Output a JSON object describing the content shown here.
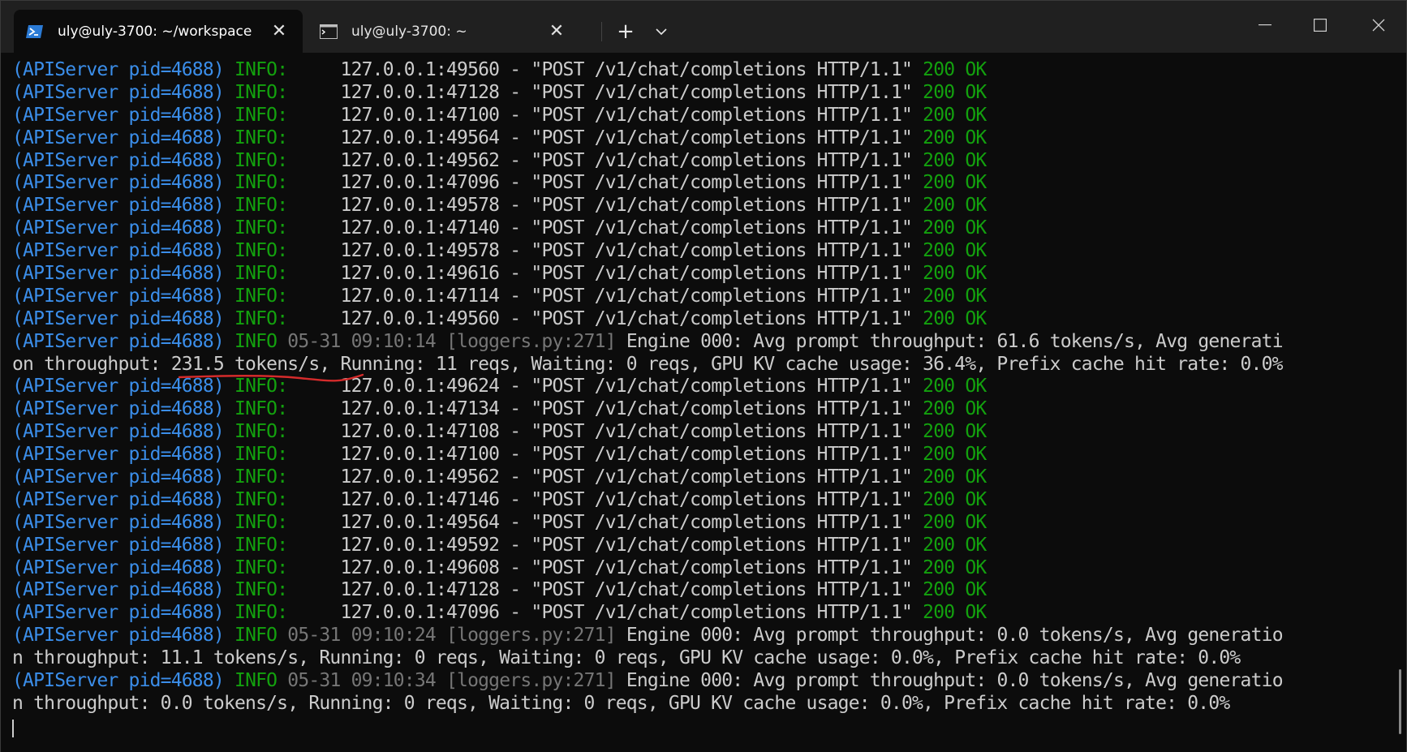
{
  "tabs": [
    {
      "label": "uly@uly-3700: ~/workspace",
      "icon": "powershell-icon",
      "active": true
    },
    {
      "label": "uly@uly-3700: ~",
      "icon": "terminal-icon",
      "active": false
    }
  ],
  "controls": {
    "new_tab": "+",
    "close": "✕"
  },
  "colors": {
    "pid": "#3b8eea",
    "info": "#13a10e",
    "ok": "#13a10e",
    "timestamp": "#767676",
    "text": "#cccccc",
    "annotation": "#d42b2b"
  },
  "log": {
    "pid": "(APIServer pid=4688)",
    "info": "INFO:",
    "info_bare": "INFO",
    "status": "200 OK",
    "request": "\"POST /v1/chat/completions HTTP/1.1\"",
    "requests_a": [
      "127.0.0.1:49560",
      "127.0.0.1:47128",
      "127.0.0.1:47100",
      "127.0.0.1:49564",
      "127.0.0.1:49562",
      "127.0.0.1:47096",
      "127.0.0.1:49578",
      "127.0.0.1:47140",
      "127.0.0.1:49578",
      "127.0.0.1:49616",
      "127.0.0.1:47114",
      "127.0.0.1:49560"
    ],
    "metric1": {
      "timestamp": "05-31 09:10:14 [loggers.py:271]",
      "line1_text": "Engine 000: Avg prompt throughput: 61.6 tokens/s, Avg generati",
      "line2_pre": "on throughput: ",
      "line2_highlight": "231.5 tokens/s,",
      "line2_post": " Running: 11 reqs, Waiting: 0 reqs, GPU KV cache usage: 36.4%, Prefix cache hit rate: 0.0%"
    },
    "requests_b": [
      "127.0.0.1:49624",
      "127.0.0.1:47134",
      "127.0.0.1:47108",
      "127.0.0.1:47100",
      "127.0.0.1:49562",
      "127.0.0.1:47146",
      "127.0.0.1:49564",
      "127.0.0.1:49592",
      "127.0.0.1:49608",
      "127.0.0.1:47128",
      "127.0.0.1:47096"
    ],
    "metric2": {
      "timestamp": "05-31 09:10:24 [loggers.py:271]",
      "line1_text": "Engine 000: Avg prompt throughput: 0.0 tokens/s, Avg generatio",
      "line2_text": "n throughput: 11.1 tokens/s, Running: 0 reqs, Waiting: 0 reqs, GPU KV cache usage: 0.0%, Prefix cache hit rate: 0.0%"
    },
    "metric3": {
      "timestamp": "05-31 09:10:34 [loggers.py:271]",
      "line1_text": "Engine 000: Avg prompt throughput: 0.0 tokens/s, Avg generatio",
      "line2_text": "n throughput: 0.0 tokens/s, Running: 0 reqs, Waiting: 0 reqs, GPU KV cache usage: 0.0%, Prefix cache hit rate: 0.0%"
    }
  }
}
